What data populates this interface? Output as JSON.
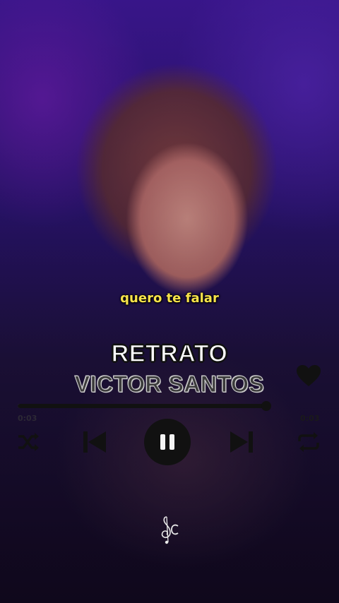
{
  "lyrics": {
    "current_line": "quero te falar"
  },
  "song": {
    "title": "RETRATO",
    "artist": "VICTOR SANTOS"
  },
  "player": {
    "elapsed": "0:03",
    "remaining": "0:03",
    "progress": 1.0,
    "state": "playing"
  },
  "icons": {
    "favorite": "heart-icon",
    "shuffle": "shuffle-icon",
    "previous": "skip-previous-icon",
    "pause": "pause-icon",
    "next": "skip-next-icon",
    "repeat": "repeat-icon",
    "logo": "music-note-logo"
  },
  "colors": {
    "lyric": "#f7e34a",
    "title": "#ffffff",
    "artist": "#3b3b3b",
    "controls": "#111111"
  }
}
